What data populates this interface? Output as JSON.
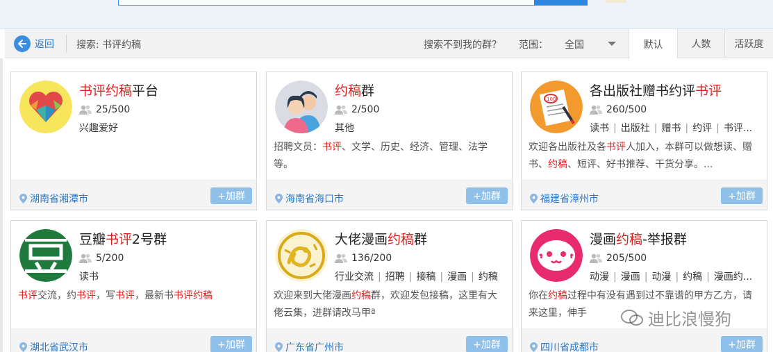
{
  "toolbar": {
    "back_label": "返回",
    "search_label": "搜索: 书评约稿",
    "not_found": "搜索不到我的群？",
    "range_label": "范围：",
    "range_value": "全国",
    "sort_tabs": [
      "默认",
      "人数",
      "活跃度"
    ]
  },
  "cards": [
    {
      "name_parts": [
        {
          "t": "书评约稿",
          "hl": true
        },
        {
          "t": "平台",
          "hl": false
        }
      ],
      "members": "25/500",
      "tags": [
        "兴趣爱好"
      ],
      "desc_parts": [],
      "location": "湖南省湘潭市",
      "join": "+加群",
      "avatar": "heart-logo"
    },
    {
      "name_parts": [
        {
          "t": "约稿",
          "hl": true
        },
        {
          "t": "群",
          "hl": false
        }
      ],
      "members": "2/500",
      "tags": [
        "其他"
      ],
      "desc_parts": [
        {
          "t": "招聘文员：",
          "hl": false
        },
        {
          "t": "书评",
          "hl": true
        },
        {
          "t": "、文学、历史、经济、管理、法学等。",
          "hl": false
        }
      ],
      "location": "海南省海口市",
      "join": "+加群",
      "avatar": "couple-illustration"
    },
    {
      "name_parts": [
        {
          "t": "各出版社赠书约评",
          "hl": false
        },
        {
          "t": "书评",
          "hl": true
        }
      ],
      "members": "260/500",
      "tags": [
        "读书",
        "出版社",
        "赠书",
        "约评",
        "书评..."
      ],
      "desc_parts": [
        {
          "t": "欢迎各出版社及各",
          "hl": false
        },
        {
          "t": "书评",
          "hl": true
        },
        {
          "t": "人加入，本群可以做想读、赠书、",
          "hl": false
        },
        {
          "t": "约稿",
          "hl": true
        },
        {
          "t": "、短评、好书推荐、干货分享。...",
          "hl": false
        }
      ],
      "location": "福建省漳州市",
      "join": "+加群",
      "avatar": "score-paper-icon"
    },
    {
      "name_parts": [
        {
          "t": "豆瓣",
          "hl": false
        },
        {
          "t": "书评",
          "hl": true
        },
        {
          "t": "2号群",
          "hl": false
        }
      ],
      "members": "5/200",
      "tags": [
        "读书"
      ],
      "desc_parts": [
        {
          "t": "书评",
          "hl": true
        },
        {
          "t": "交流，约",
          "hl": false
        },
        {
          "t": "书评",
          "hl": true
        },
        {
          "t": "，写",
          "hl": false
        },
        {
          "t": "书评",
          "hl": true
        },
        {
          "t": "，最新书",
          "hl": false
        },
        {
          "t": "书评约稿",
          "hl": true
        }
      ],
      "location": "湖北省武汉市",
      "join": "+加群",
      "avatar": "douban-logo",
      "avatar_text": "豆"
    },
    {
      "name_parts": [
        {
          "t": "大佬漫画",
          "hl": false
        },
        {
          "t": "约稿",
          "hl": true
        },
        {
          "t": "群",
          "hl": false
        }
      ],
      "members": "136/200",
      "tags": [
        "行业交流",
        "招聘",
        "接稿",
        "漫画",
        "约稿"
      ],
      "desc_parts": [
        {
          "t": "欢迎来到大佬漫画",
          "hl": false
        },
        {
          "t": "约稿",
          "hl": true
        },
        {
          "t": "群，欢迎发包接稿，这里有大佬云集，进群请改马甲ª",
          "hl": false
        }
      ],
      "location": "广东省广州市",
      "join": "+加群",
      "avatar": "golden-dragon-emblem"
    },
    {
      "name_parts": [
        {
          "t": "漫画",
          "hl": false
        },
        {
          "t": "约稿",
          "hl": true
        },
        {
          "t": "-举报群",
          "hl": false
        }
      ],
      "members": "205/500",
      "tags": [
        "动漫",
        "漫画",
        "动漫",
        "约稿",
        "漫画约..."
      ],
      "desc_parts": [
        {
          "t": "你在",
          "hl": false
        },
        {
          "t": "约稿",
          "hl": true
        },
        {
          "t": "过程中有没有遇到过不靠谱的甲方乙方，请来这里，伸手",
          "hl": false
        }
      ],
      "location": "四川省成都市",
      "join": "+加群",
      "avatar": "pink-face-sticker"
    }
  ],
  "watermark": "迪比浪慢狗",
  "colors": {
    "highlight": "#e02020",
    "link": "#2a78c8",
    "join_button": "#8ec0ea",
    "accent": "#3b8de0"
  }
}
